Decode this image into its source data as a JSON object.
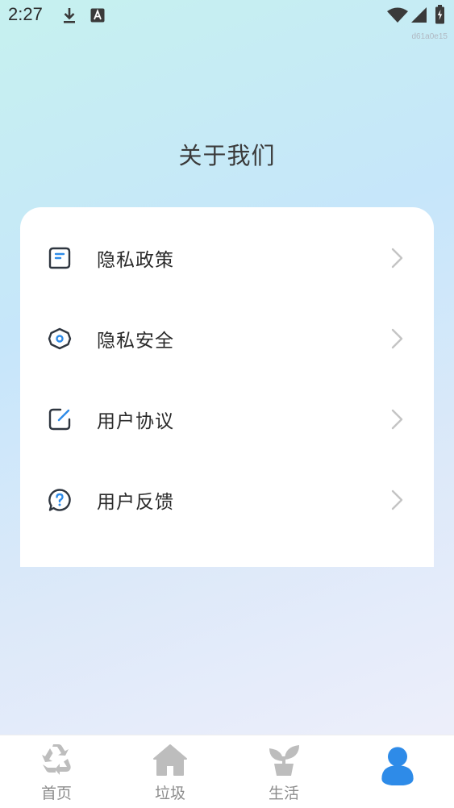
{
  "status_bar": {
    "time": "2:27",
    "device_id": "d61a0e15"
  },
  "page": {
    "title": "关于我们"
  },
  "menu": {
    "items": [
      {
        "label": "隐私政策",
        "icon": "document-icon"
      },
      {
        "label": "隐私安全",
        "icon": "shield-icon"
      },
      {
        "label": "用户协议",
        "icon": "edit-icon"
      },
      {
        "label": "用户反馈",
        "icon": "help-icon"
      }
    ]
  },
  "tabs": [
    {
      "label": "首页",
      "icon": "recycle-icon",
      "active": false
    },
    {
      "label": "垃圾",
      "icon": "home-icon",
      "active": false
    },
    {
      "label": "生活",
      "icon": "plant-icon",
      "active": false
    },
    {
      "label": "",
      "icon": "user-icon",
      "active": true
    }
  ],
  "colors": {
    "accent": "#2e8be8",
    "icon_dark": "#2f3640",
    "tab_inactive": "#bdbdbd",
    "chevron": "#c4c4c4"
  }
}
